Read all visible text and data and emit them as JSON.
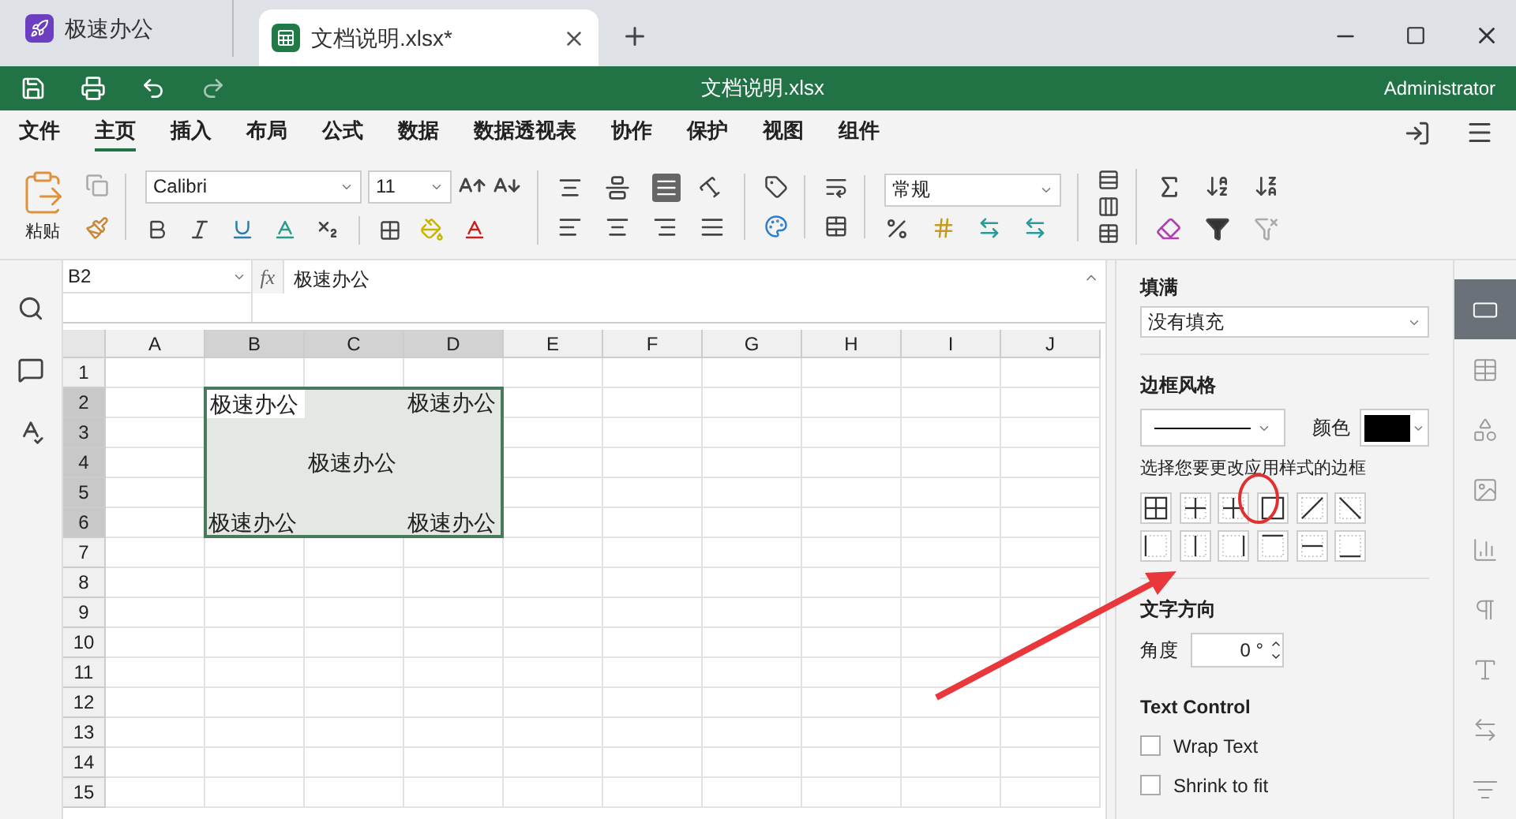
{
  "app_tabs": [
    {
      "kind": "home",
      "label": "极速办公",
      "selected": false
    },
    {
      "kind": "sheet",
      "label": "文档说明.xlsx*",
      "selected": true
    }
  ],
  "title_bar": {
    "title": "文档说明.xlsx",
    "user": "Administrator"
  },
  "menu": [
    {
      "label": "文件",
      "selected": false
    },
    {
      "label": "主页",
      "selected": true
    },
    {
      "label": "插入",
      "selected": false
    },
    {
      "label": "布局",
      "selected": false
    },
    {
      "label": "公式",
      "selected": false
    },
    {
      "label": "数据",
      "selected": false
    },
    {
      "label": "数据透视表",
      "selected": false
    },
    {
      "label": "协作",
      "selected": false
    },
    {
      "label": "保护",
      "selected": false
    },
    {
      "label": "视图",
      "selected": false
    },
    {
      "label": "组件",
      "selected": false
    }
  ],
  "ribbon": {
    "paste": "粘贴",
    "font": "Calibri",
    "size": "11",
    "number_format": "常规"
  },
  "formula_bar": {
    "name_box": "B2",
    "function_label": "fx",
    "value": "极速办公"
  },
  "sheet": {
    "columns": [
      {
        "label": "A",
        "selected": false
      },
      {
        "label": "B",
        "selected": true
      },
      {
        "label": "C",
        "selected": true
      },
      {
        "label": "D",
        "selected": true
      },
      {
        "label": "E",
        "selected": false
      },
      {
        "label": "F",
        "selected": false
      },
      {
        "label": "G",
        "selected": false
      },
      {
        "label": "H",
        "selected": false
      },
      {
        "label": "I",
        "selected": false
      },
      {
        "label": "J",
        "selected": false
      }
    ],
    "rows": [
      {
        "label": "1",
        "selected": false
      },
      {
        "label": "2",
        "selected": true,
        "cells": [
          null,
          {
            "text": "极速办公",
            "active": true
          },
          null,
          {
            "text": "极速办公",
            "active": false
          }
        ]
      },
      {
        "label": "3",
        "selected": true
      },
      {
        "label": "4",
        "selected": true,
        "cells": [
          null,
          null,
          {
            "text": "极速办公",
            "active": false
          }
        ]
      },
      {
        "label": "5",
        "selected": true
      },
      {
        "label": "6",
        "selected": true,
        "cells": [
          null,
          {
            "text": "极速办公",
            "active": false
          },
          null,
          {
            "text": "极速办公",
            "active": false
          }
        ]
      },
      {
        "label": "7",
        "selected": false
      },
      {
        "label": "8",
        "selected": false
      },
      {
        "label": "9",
        "selected": false
      },
      {
        "label": "10",
        "selected": false
      },
      {
        "label": "11",
        "selected": false
      },
      {
        "label": "12",
        "selected": false
      },
      {
        "label": "13",
        "selected": false
      },
      {
        "label": "14",
        "selected": false
      },
      {
        "label": "15",
        "selected": false
      }
    ]
  },
  "side_panel": {
    "fill_label": "填满",
    "fill_value": "没有填充",
    "border_style_label": "边框风格",
    "color_label": "颜色",
    "border_hint": "选择您要更改应用样式的边框",
    "text_direction_label": "文字方向",
    "angle_label": "角度",
    "angle_value": "0 °",
    "text_control_label": "Text Control",
    "options": [
      {
        "label": "Wrap Text",
        "checked": false
      },
      {
        "label": "Shrink to fit",
        "checked": false
      }
    ]
  },
  "side_tabs": [
    {
      "kind": "cell",
      "selected": true
    },
    {
      "kind": "table",
      "selected": false
    },
    {
      "kind": "shape",
      "selected": false
    },
    {
      "kind": "image",
      "selected": false
    },
    {
      "kind": "chart",
      "selected": false
    },
    {
      "kind": "paragraph",
      "selected": false
    },
    {
      "kind": "text-art",
      "selected": false
    },
    {
      "kind": "pivot",
      "selected": false
    },
    {
      "kind": "slicer",
      "selected": false
    }
  ]
}
